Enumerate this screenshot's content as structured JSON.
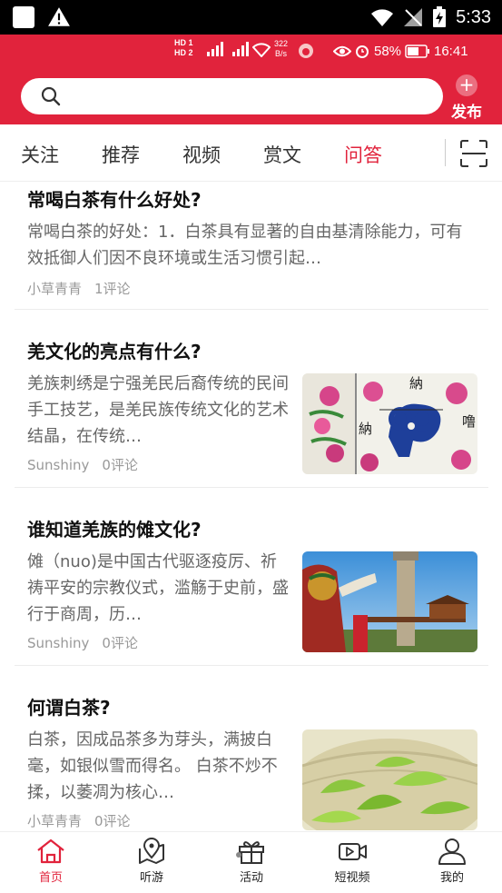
{
  "system_status": {
    "time": "5:33"
  },
  "inner_status": {
    "hd1": "HD 1",
    "hd2": "HD 2",
    "signal": "4G  5G",
    "speed_value": "322",
    "speed_unit": "B/s",
    "battery": "58%",
    "clock": "16:41"
  },
  "header": {
    "publish_label": "发布"
  },
  "tabs": [
    {
      "label": "关注"
    },
    {
      "label": "推荐"
    },
    {
      "label": "视频"
    },
    {
      "label": "赏文"
    },
    {
      "label": "问答"
    }
  ],
  "active_tab": "问答",
  "feed": [
    {
      "title": "常喝白茶有什么好处?",
      "summary": "常喝白茶的好处：1．白茶具有显著的自由基清除能力，可有效抵御人们因不良环境或生活习惯引起…",
      "author": "小草青青",
      "comments": "1评论"
    },
    {
      "title": "羌文化的亮点有什么?",
      "summary": "羌族刺绣是宁强羌民后裔传统的民间手工技艺，是羌民族传统文化的艺术结晶，在传统…",
      "author": "Sunshiny",
      "comments": "0评论",
      "thumb_text": {
        "a": "納",
        "b": "納",
        "c": "噜"
      }
    },
    {
      "title": "谁知道羌族的傩文化?",
      "summary": "傩（nuo)是中国古代驱逐疫厉、祈祷平安的宗教仪式，滥觞于史前，盛行于商周，历…",
      "author": "Sunshiny",
      "comments": "0评论"
    },
    {
      "title": "何谓白茶?",
      "summary": "白茶，因成品茶多为芽头，满披白毫，如银似雪而得名。 白茶不炒不揉，以萎凋为核心…",
      "author": "小草青青",
      "comments": "0评论"
    }
  ],
  "bottom_nav": [
    {
      "label": "首页",
      "icon": "home-icon"
    },
    {
      "label": "听游",
      "icon": "map-pin-icon"
    },
    {
      "label": "活动",
      "icon": "gift-icon"
    },
    {
      "label": "短视频",
      "icon": "video-icon"
    },
    {
      "label": "我的",
      "icon": "user-icon"
    }
  ],
  "colors": {
    "accent": "#e1233c",
    "muted_text": "#999999"
  }
}
